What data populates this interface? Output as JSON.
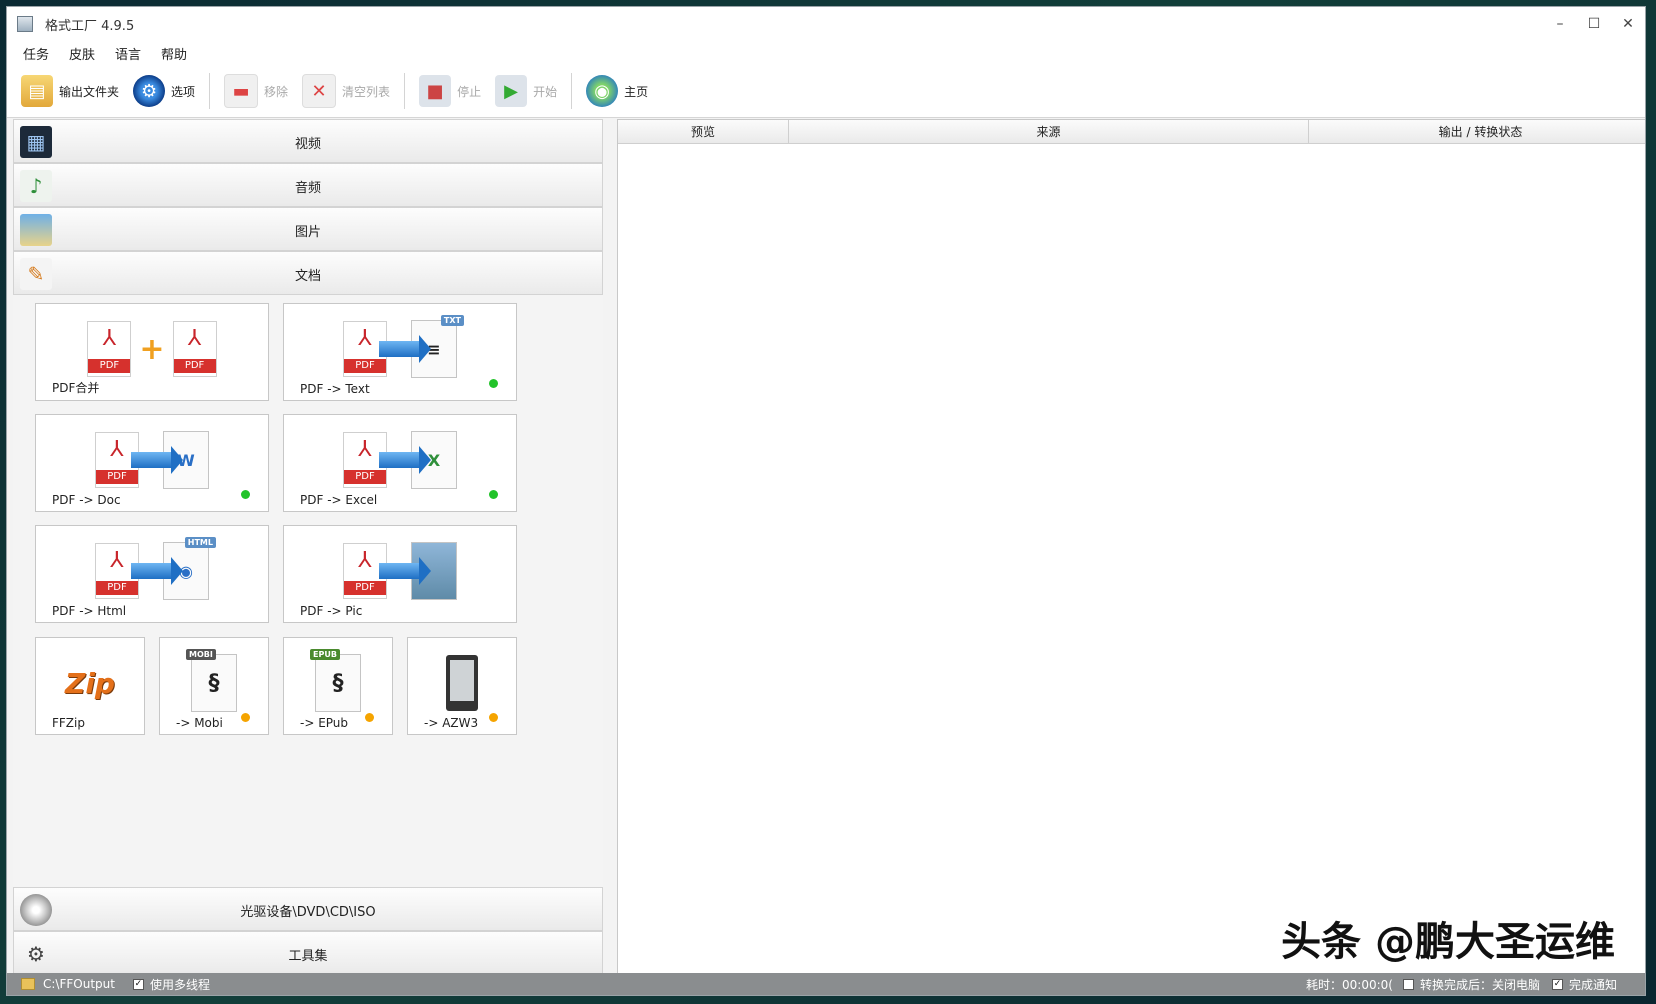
{
  "window": {
    "title": "格式工厂 4.9.5",
    "controls": {
      "minimize": "–",
      "maximize": "☐",
      "close": "✕"
    }
  },
  "menu": [
    "任务",
    "皮肤",
    "语言",
    "帮助"
  ],
  "toolbar": {
    "output_folder": "输出文件夹",
    "options": "选项",
    "remove": "移除",
    "clear_list": "清空列表",
    "stop": "停止",
    "start": "开始",
    "home": "主页"
  },
  "categories": {
    "video": "视频",
    "audio": "音频",
    "picture": "图片",
    "document": "文档",
    "optical": "光驱设备\\DVD\\CD\\ISO",
    "tools": "工具集"
  },
  "tiles": {
    "pdf_merge": {
      "label": "PDF合并",
      "tag1": "PDF",
      "tag2": "PDF"
    },
    "pdf_text": {
      "label": "PDF -> Text",
      "src_tag": "PDF",
      "target_tag": "TXT"
    },
    "pdf_doc": {
      "label": "PDF -> Doc",
      "src_tag": "PDF",
      "target_glyph": "W"
    },
    "pdf_excel": {
      "label": "PDF -> Excel",
      "src_tag": "PDF",
      "target_glyph": "X"
    },
    "pdf_html": {
      "label": "PDF -> Html",
      "src_tag": "PDF",
      "target_tag": "HTML"
    },
    "pdf_pic": {
      "label": "PDF -> Pic",
      "src_tag": "PDF"
    },
    "ffzip": {
      "label": "FFZip",
      "glyph": "Zip"
    },
    "mobi": {
      "label": "-> Mobi",
      "tag": "MOBI"
    },
    "epub": {
      "label": "-> EPub",
      "tag": "EPUB"
    },
    "azw3": {
      "label": "-> AZW3"
    }
  },
  "list_headers": [
    "预览",
    "来源",
    "输出 / 转换状态"
  ],
  "status": {
    "output_path": "C:\\FFOutput",
    "multithread": "使用多线程",
    "elapsed": "耗时：00:00:0(",
    "after_done": "转换完成后：关闭电脑",
    "notify": "完成通知"
  },
  "watermark": "头条 @鹏大圣运维",
  "colors": {
    "dot_green": "#22c32a",
    "dot_orange": "#f5a400",
    "pdf_red": "#d6312d"
  }
}
